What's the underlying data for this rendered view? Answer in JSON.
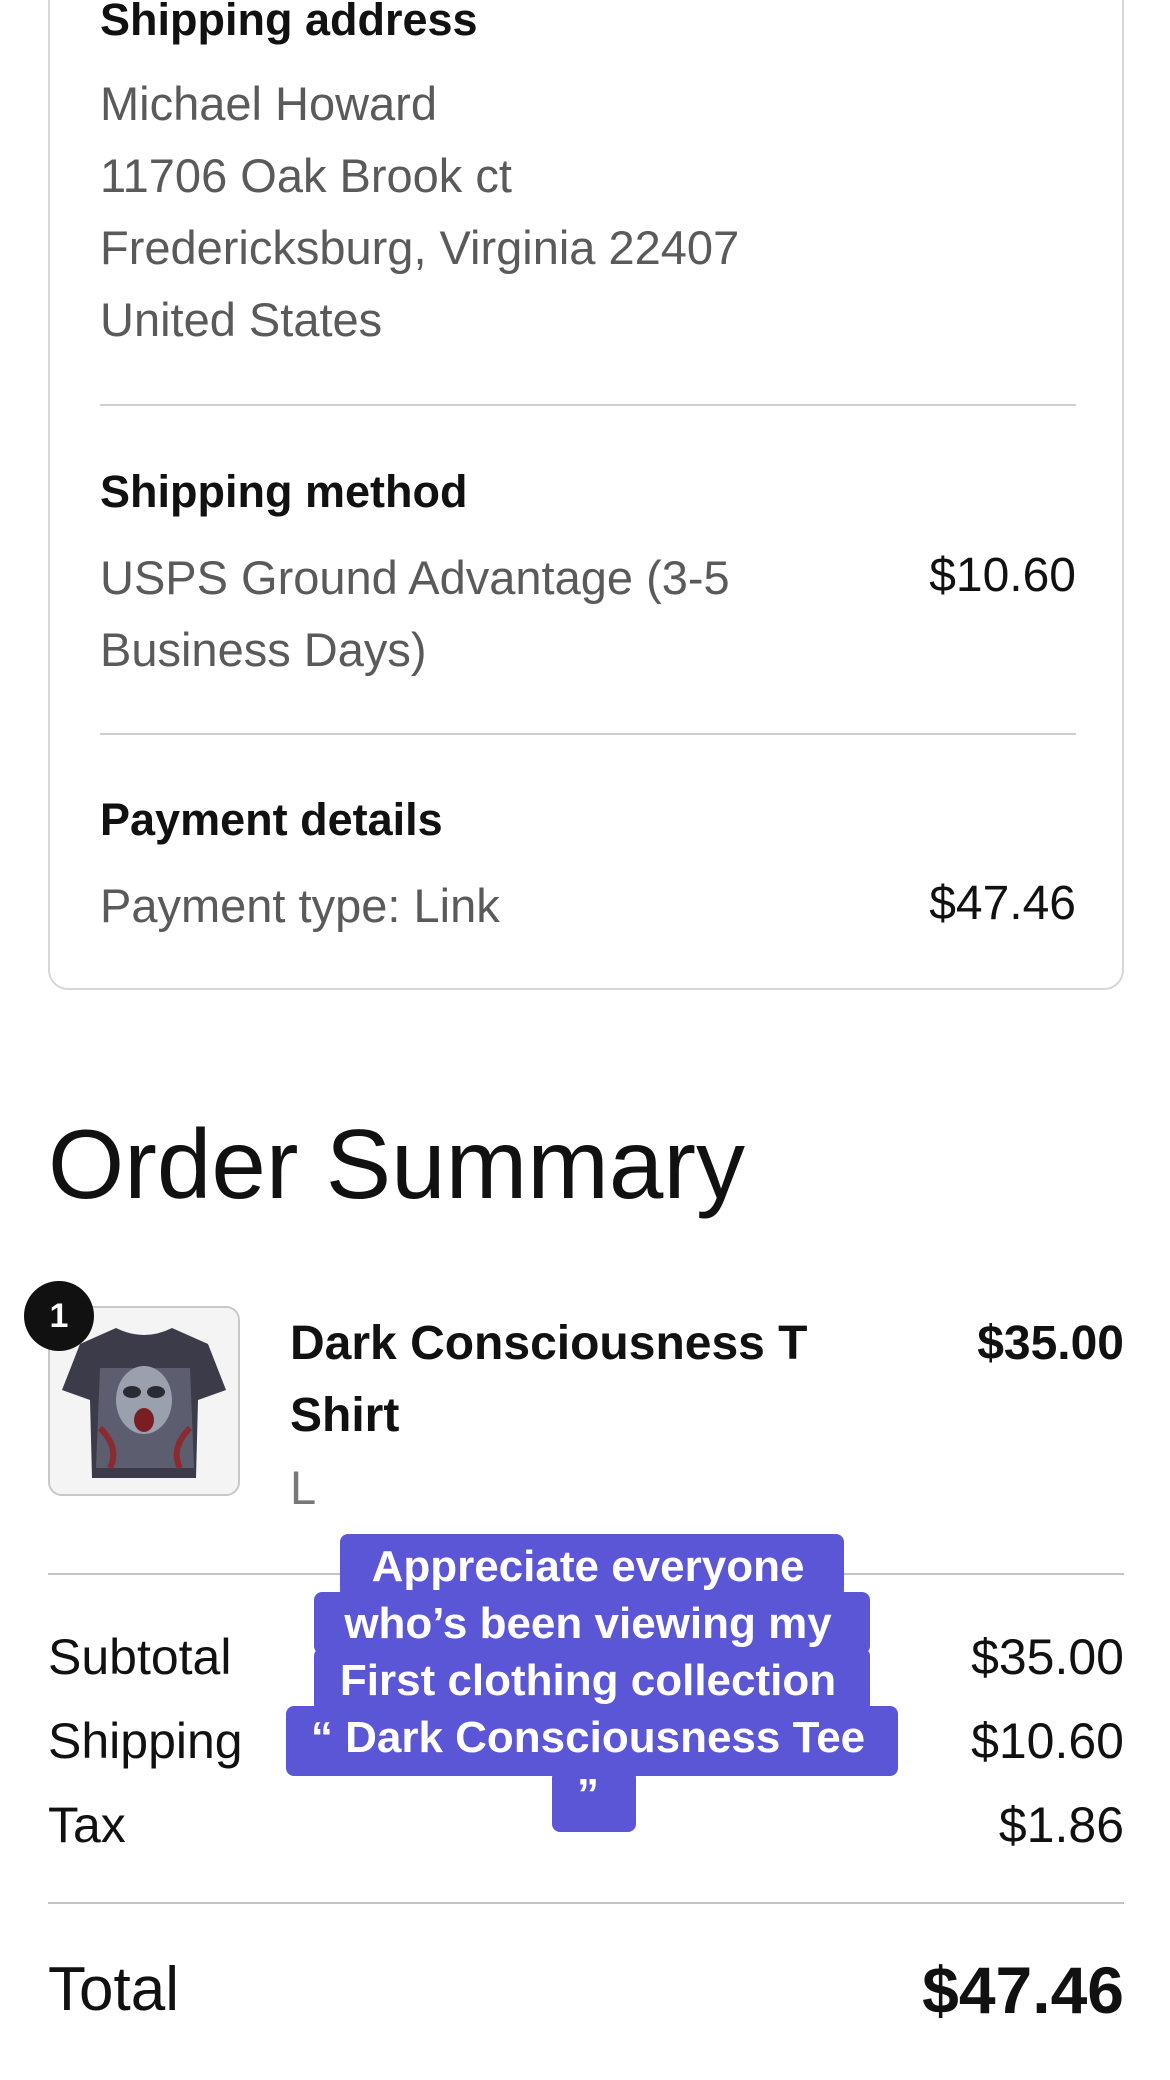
{
  "shipping_address": {
    "title": "Shipping address",
    "name": "Michael Howard",
    "street": "11706 Oak Brook ct",
    "city_line": "Fredericksburg, Virginia 22407",
    "country": "United States"
  },
  "shipping_method": {
    "title": "Shipping method",
    "line1": "USPS Ground Advantage (3-5",
    "line2": "Business Days)",
    "price": "$10.60"
  },
  "payment_details": {
    "title": "Payment details",
    "type": "Payment type: Link",
    "amount": "$47.46"
  },
  "order_summary": {
    "title": "Order Summary",
    "item": {
      "quantity": "1",
      "name_line1": "Dark Consciousness T",
      "name_line2": "Shirt",
      "size": "L",
      "price": "$35.00"
    },
    "subtotal_label": "Subtotal",
    "subtotal_value": "$35.00",
    "shipping_label": "Shipping",
    "shipping_value": "$10.60",
    "tax_label": "Tax",
    "tax_value": "$1.86",
    "total_label": "Total",
    "total_value": "$47.46"
  },
  "caption": {
    "line1": "Appreciate everyone",
    "line2": "who’s been viewing my",
    "line3": "First clothing collection",
    "line4": "“ Dark Consciousness Tee",
    "line5": "”"
  },
  "colors": {
    "caption_bg": "#5b56d6",
    "text_primary": "#111111",
    "text_secondary": "#5a5a5a",
    "border": "#d6d6d6"
  }
}
